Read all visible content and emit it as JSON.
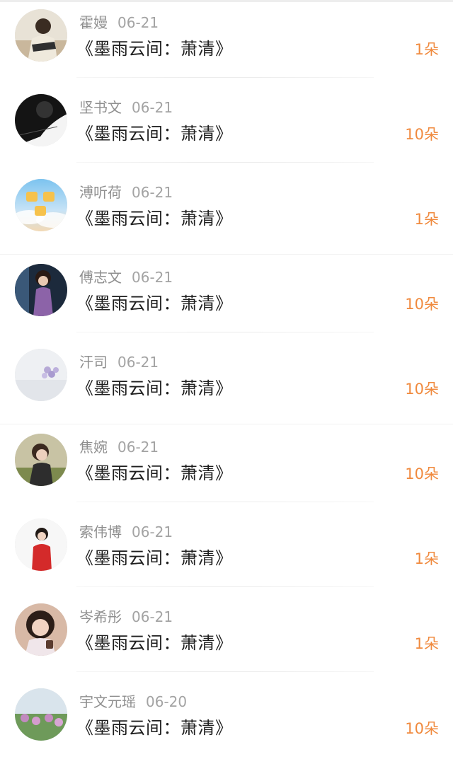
{
  "gift_list": [
    {
      "name": "霍嫚",
      "date": "06-21",
      "title": "《墨雨云间：萧清》",
      "amount": "1朵",
      "avatar": "avatar-student"
    },
    {
      "name": "坚书文",
      "date": "06-21",
      "title": "《墨雨云间：萧清》",
      "amount": "10朵",
      "avatar": "avatar-dark-portrait"
    },
    {
      "name": "溥听荷",
      "date": "06-21",
      "title": "《墨雨云间：萧清》",
      "amount": "1朵",
      "avatar": "avatar-sky-text"
    },
    {
      "name": "傅志文",
      "date": "06-21",
      "title": "《墨雨云间：萧清》",
      "amount": "10朵",
      "avatar": "avatar-woman-dress"
    },
    {
      "name": "汗司",
      "date": "06-21",
      "title": "《墨雨云间：萧清》",
      "amount": "10朵",
      "avatar": "avatar-flowers"
    },
    {
      "name": "焦婉",
      "date": "06-21",
      "title": "《墨雨云间：萧清》",
      "amount": "10朵",
      "avatar": "avatar-girl-field"
    },
    {
      "name": "索伟博",
      "date": "06-21",
      "title": "《墨雨云间：萧清》",
      "amount": "1朵",
      "avatar": "avatar-girl-red"
    },
    {
      "name": "岑希彤",
      "date": "06-21",
      "title": "《墨雨云间：萧清》",
      "amount": "1朵",
      "avatar": "avatar-girl-cup"
    },
    {
      "name": "宇文元瑶",
      "date": "06-20",
      "title": "《墨雨云间：萧清》",
      "amount": "10朵",
      "avatar": "avatar-garden"
    }
  ],
  "colors": {
    "amount": "#f08a3e",
    "name": "#8f8f8f",
    "title": "#1f1f1f"
  }
}
